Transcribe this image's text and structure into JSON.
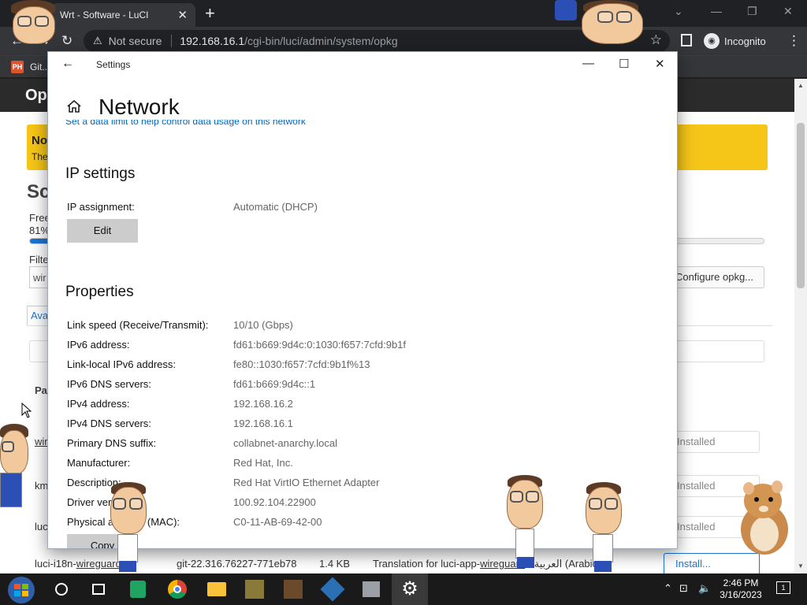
{
  "browser": {
    "tab_title": "Wrt - Software - LuCI",
    "tab_close": "✕",
    "new_tab": "+",
    "win_minimize": "—",
    "win_restore": "❐",
    "win_close": "✕",
    "back": "←",
    "forward": "→",
    "reload": "↻",
    "not_secure": "Not secure",
    "url_host": "192.168.16.1",
    "url_path": "/cgi-bin/luci/admin/system/opkg",
    "star": "☆",
    "incognito_label": "Incognito",
    "menu": "⋮",
    "bookmark_label": "Git..."
  },
  "luci": {
    "header": "Op",
    "banner_title": "No",
    "banner_sub": "The",
    "title": "Sc",
    "free_label": "Free",
    "free_pct": "81%",
    "free_fraction": 0.81,
    "filter_label": "Filte",
    "filter_value": "wir",
    "configure_button": "Configure opkg...",
    "tab_label": "Ava",
    "col_header": "Pa",
    "rows": [
      {
        "name": "wir",
        "status": "Installed"
      },
      {
        "name": "km",
        "status": "Installed"
      },
      {
        "name": "luc",
        "status": "Installed"
      }
    ],
    "last_row": {
      "name_prefix": "luci-i18n-",
      "name_link": "wireguard",
      "version": "git-22.316.76227-771eb78",
      "size": "1.4 KB",
      "desc_prefix": "Translation for luci-app-",
      "desc_link": "wireguard",
      "desc_suffix": " - العربية (Arabic)",
      "action": "Install..."
    }
  },
  "settings": {
    "window_title": "Settings",
    "back": "←",
    "minimize": "—",
    "maximize": "☐",
    "close": "✕",
    "heading": "Network",
    "link_text": "Set a data limit to help control data usage on this network",
    "ip_section": "IP settings",
    "ip_assignment_label": "IP assignment:",
    "ip_assignment_value": "Automatic (DHCP)",
    "edit_button": "Edit",
    "properties_section": "Properties",
    "properties": [
      {
        "label": "Link speed (Receive/Transmit):",
        "value": "10/10 (Gbps)"
      },
      {
        "label": "IPv6 address:",
        "value": "fd61:b669:9d4c:0:1030:f657:7cfd:9b1f"
      },
      {
        "label": "Link-local IPv6 address:",
        "value": "fe80::1030:f657:7cfd:9b1f%13"
      },
      {
        "label": "IPv6 DNS servers:",
        "value": "fd61:b669:9d4c::1"
      },
      {
        "label": "IPv4 address:",
        "value": "192.168.16.2"
      },
      {
        "label": "IPv4 DNS servers:",
        "value": "192.168.16.1"
      },
      {
        "label": "Primary DNS suffix:",
        "value": "collabnet-anarchy.local"
      },
      {
        "label": "Manufacturer:",
        "value": "Red Hat, Inc."
      },
      {
        "label": "Description:",
        "value": "Red Hat VirtIO Ethernet Adapter"
      },
      {
        "label": "Driver version:",
        "value": "100.92.104.22900"
      },
      {
        "label": "Physical address (MAC):",
        "value": "C0-11-AB-69-42-00"
      }
    ],
    "copy_button": "Copy"
  },
  "taskbar": {
    "time": "2:46 PM",
    "date": "3/16/2023",
    "notification_count": "1"
  },
  "colors": {
    "accent": "#1c74d1",
    "banner": "#f5c518",
    "settings_link": "#0067c0"
  }
}
